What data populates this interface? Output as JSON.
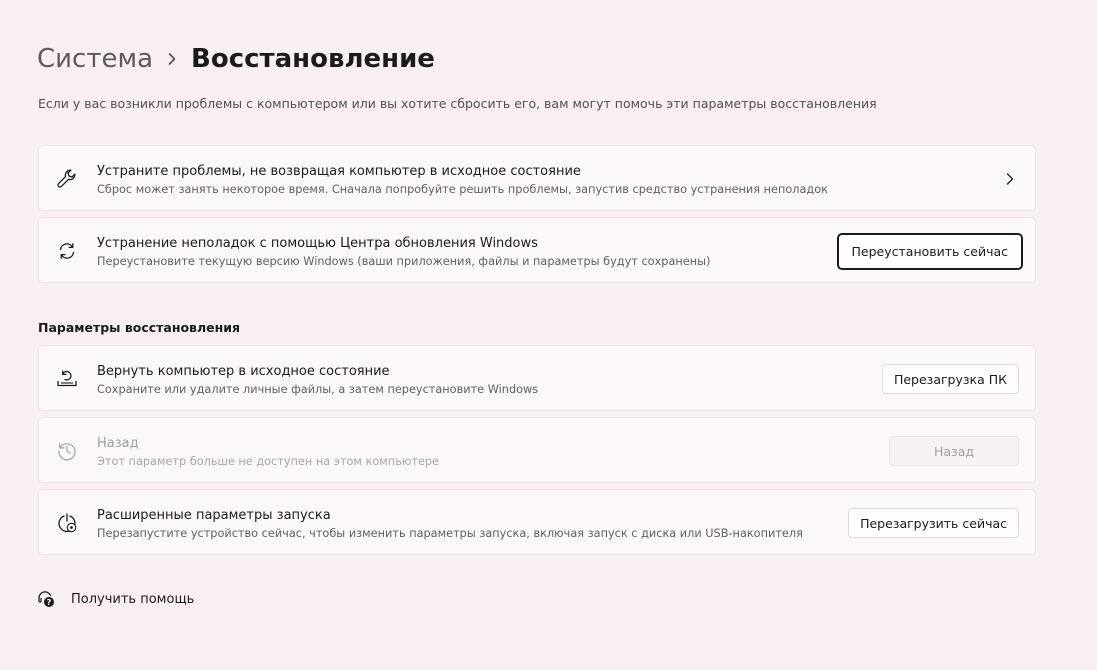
{
  "breadcrumb": {
    "parent": "Система",
    "current": "Восстановление"
  },
  "description": "Если у вас возникли проблемы с компьютером или вы хотите сбросить его, вам могут помочь эти параметры восстановления",
  "cards": [
    {
      "icon": "wrench-icon",
      "title": "Устраните проблемы, не возвращая компьютер в исходное состояние",
      "subtitle": "Сброс может занять некоторое время. Сначала попробуйте решить проблемы, запустив средство устранения неполадок"
    },
    {
      "icon": "sync-icon",
      "title": "Устранение неполадок с помощью Центра обновления Windows",
      "subtitle": "Переустановите текущую версию Windows (ваши приложения, файлы и параметры будут сохранены)",
      "button": "Переустановить сейчас"
    }
  ],
  "section_header": "Параметры восстановления",
  "recovery_options": [
    {
      "icon": "reset-pc-icon",
      "title": "Вернуть компьютер в исходное состояние",
      "subtitle": "Сохраните или удалите личные файлы, а затем переустановите Windows",
      "button": "Перезагрузка ПК"
    },
    {
      "icon": "history-icon",
      "title": "Назад",
      "subtitle": "Этот параметр больше не доступен на этом компьютере",
      "button": "Назад",
      "disabled": true
    },
    {
      "icon": "advanced-startup-icon",
      "title": "Расширенные параметры запуска",
      "subtitle": "Перезапустите устройство сейчас, чтобы изменить параметры запуска, включая запуск с диска или USB-накопителя",
      "button": "Перезагрузить сейчас"
    }
  ],
  "help": {
    "icon": "help-icon",
    "label": "Получить помощь"
  },
  "colors": {
    "background": "#f8eff1",
    "card": "#fcf8f9",
    "text": "#1b1b1b",
    "secondary_text": "#5f5f5f",
    "disabled_text": "#9d9d9d"
  }
}
